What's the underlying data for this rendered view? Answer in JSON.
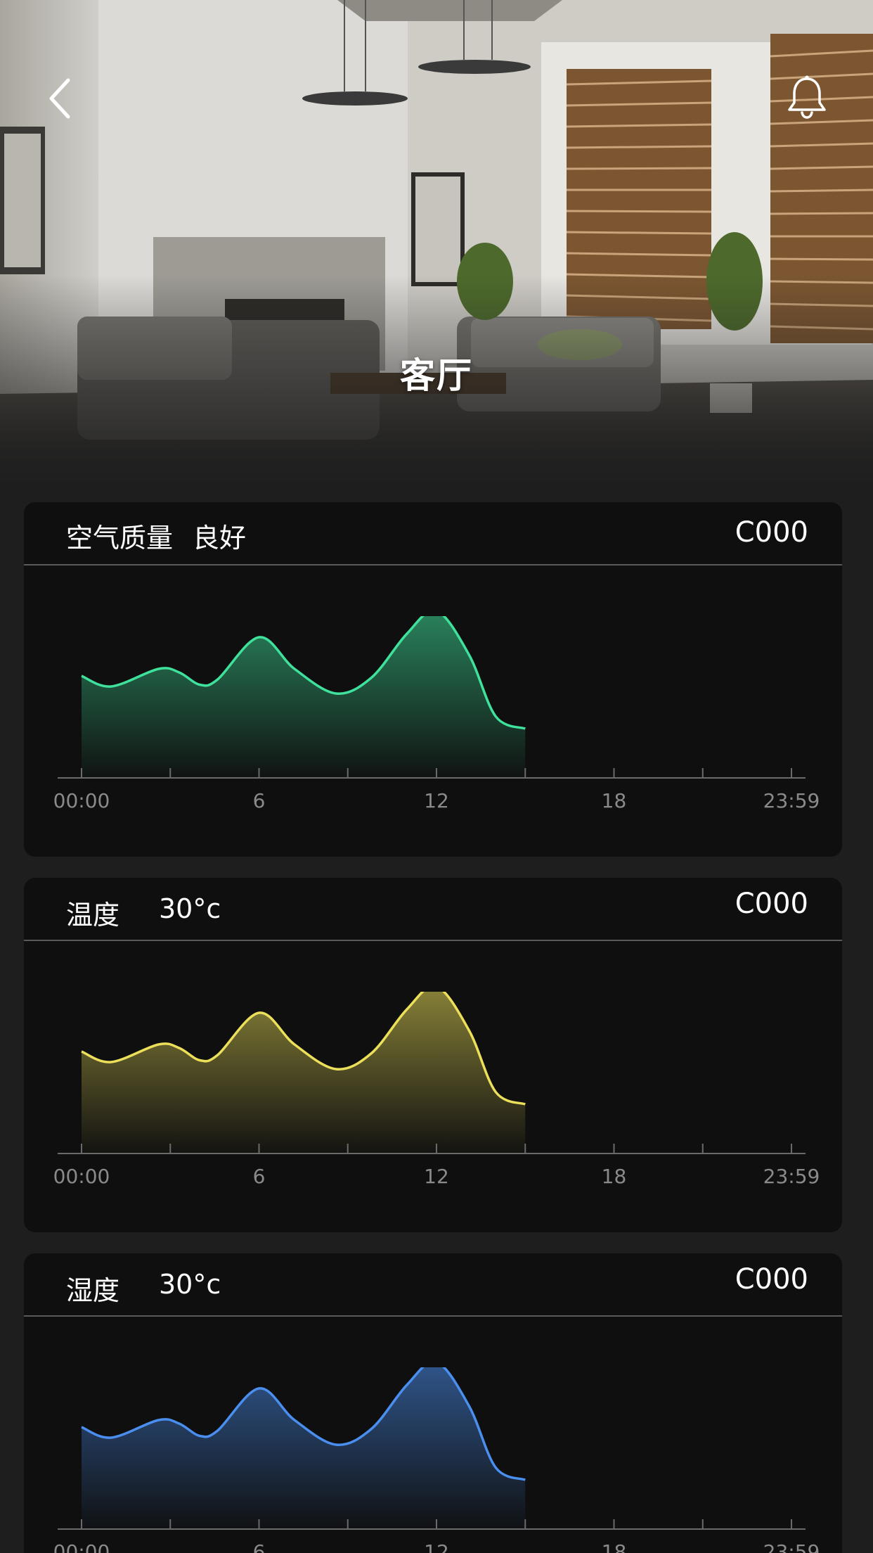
{
  "header": {
    "title": "客厅",
    "back_icon": "chevron-left-icon",
    "notify_icon": "bell-icon"
  },
  "cards": [
    {
      "title": "空气质量",
      "value": "良好",
      "code": "C000",
      "accent": "#3fe29c"
    },
    {
      "title": "温度",
      "value": "30°c",
      "code": "C000",
      "accent": "#ece05a"
    },
    {
      "title": "湿度",
      "value": "30°c",
      "code": "C000",
      "accent": "#4a8ff0"
    }
  ],
  "chart_data": [
    {
      "type": "area",
      "series": [
        {
          "values": [
            [
              0,
              58
            ],
            [
              1,
              52
            ],
            [
              2.6,
              62
            ],
            [
              3.3,
              60
            ],
            [
              4,
              53
            ],
            [
              4.6,
              56
            ],
            [
              6,
              80
            ],
            [
              7.2,
              62
            ],
            [
              8.6,
              48
            ],
            [
              9.8,
              57
            ],
            [
              11,
              82
            ],
            [
              12,
              95
            ],
            [
              13.1,
              70
            ],
            [
              14,
              35
            ],
            [
              15,
              28
            ]
          ]
        }
      ],
      "xlim": [
        0,
        24
      ],
      "ylim": [
        0,
        100
      ],
      "xticks": [
        "00:00",
        "6",
        "12",
        "18",
        "23:59"
      ]
    },
    {
      "type": "area",
      "series": [
        {
          "values": [
            [
              0,
              58
            ],
            [
              1,
              52
            ],
            [
              2.6,
              62
            ],
            [
              3.3,
              60
            ],
            [
              4,
              53
            ],
            [
              4.6,
              56
            ],
            [
              6,
              80
            ],
            [
              7.2,
              62
            ],
            [
              8.6,
              48
            ],
            [
              9.8,
              57
            ],
            [
              11,
              82
            ],
            [
              12,
              95
            ],
            [
              13.1,
              70
            ],
            [
              14,
              35
            ],
            [
              15,
              28
            ]
          ]
        }
      ],
      "xlim": [
        0,
        24
      ],
      "ylim": [
        0,
        100
      ],
      "xticks": [
        "00:00",
        "6",
        "12",
        "18",
        "23:59"
      ]
    },
    {
      "type": "area",
      "series": [
        {
          "values": [
            [
              0,
              58
            ],
            [
              1,
              52
            ],
            [
              2.6,
              62
            ],
            [
              3.3,
              60
            ],
            [
              4,
              53
            ],
            [
              4.6,
              56
            ],
            [
              6,
              80
            ],
            [
              7.2,
              62
            ],
            [
              8.6,
              48
            ],
            [
              9.8,
              57
            ],
            [
              11,
              82
            ],
            [
              12,
              95
            ],
            [
              13.1,
              70
            ],
            [
              14,
              35
            ],
            [
              15,
              28
            ]
          ]
        }
      ],
      "xlim": [
        0,
        24
      ],
      "ylim": [
        0,
        100
      ],
      "xticks": [
        "00:00",
        "6",
        "12",
        "18",
        "23:59"
      ]
    }
  ]
}
